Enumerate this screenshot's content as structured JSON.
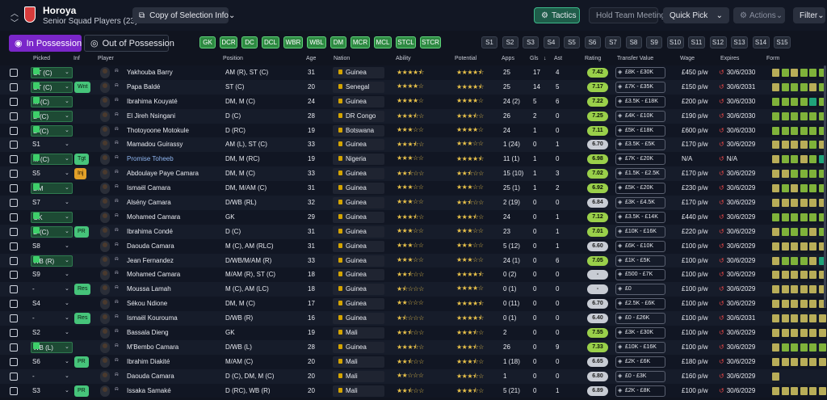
{
  "header": {
    "club_name": "Horoya",
    "squad_name": "Senior Squad Players (23)",
    "copy_label": "Copy of Selection Info",
    "tactics_label": "Tactics",
    "hold_meeting_label": "Hold Team Meeting",
    "quick_pick_label": "Quick Pick",
    "actions_label": "Actions",
    "filter_label": "Filter"
  },
  "tabs": {
    "in_possession": "In Possession",
    "out_possession": "Out of Possession"
  },
  "positions": [
    "GK",
    "DCR",
    "DC",
    "DCL",
    "WBR",
    "WBL",
    "DM",
    "MCR",
    "MCL",
    "STCL",
    "STCR"
  ],
  "subs": [
    "S1",
    "S2",
    "S3",
    "S4",
    "S5",
    "S6",
    "S7",
    "S8",
    "S9",
    "S10",
    "S11",
    "S12",
    "S13",
    "S14",
    "S15"
  ],
  "columns": {
    "picked": "Picked",
    "inf": "Inf",
    "player": "Player",
    "position": "Position",
    "age": "Age",
    "nation": "Nation",
    "ability": "Ability",
    "potential": "Potential",
    "apps": "Apps",
    "gls": "Gls",
    "ast": "Ast",
    "rating": "Rating",
    "transfer_value": "Transfer Value",
    "wage": "Wage",
    "expires": "Expires",
    "form": "Form"
  },
  "colors": {
    "good": "#46c47a",
    "accent": "#2e8a42",
    "form_green": "#7fb23a",
    "form_dark": "#4f8a1e",
    "form_yellow": "#b8ad58",
    "form_teal": "#1fa37a"
  },
  "players": [
    {
      "picked": "ST (C)",
      "set": true,
      "inf": "",
      "name": "Yakhouba Barry",
      "pos": "AM (R), ST (C)",
      "age": "31",
      "nat": "Guinea",
      "ab": 4.5,
      "pt": 4.5,
      "apps": "25",
      "gls": "17",
      "ast": "4",
      "rating": "7.42",
      "rt": "g",
      "tv": "£8K - £30K",
      "wage": "£450 p/w",
      "exp": "30/6/2030",
      "form": [
        "y",
        "g",
        "y",
        "g",
        "g",
        "g",
        "g"
      ]
    },
    {
      "picked": "ST (C)",
      "set": true,
      "inf": "Wnt",
      "name": "Papa Baldé",
      "pos": "ST (C)",
      "age": "20",
      "nat": "Senegal",
      "ab": 4,
      "pt": 4.5,
      "apps": "25",
      "gls": "14",
      "ast": "5",
      "rating": "7.17",
      "rt": "g",
      "tv": "£7K - £35K",
      "wage": "£150 p/w",
      "exp": "30/6/2031",
      "form": [
        "y",
        "g",
        "g",
        "g",
        "y",
        "g",
        "g"
      ]
    },
    {
      "picked": "M (C)",
      "set": true,
      "inf": "",
      "name": "Ibrahima Kouyaté",
      "pos": "DM, M (C)",
      "age": "24",
      "nat": "Guinea",
      "ab": 4,
      "pt": 4,
      "apps": "24 (2)",
      "gls": "5",
      "ast": "6",
      "rating": "7.22",
      "rt": "g",
      "tv": "£3.5K - £18K",
      "wage": "£200 p/w",
      "exp": "30/6/2030",
      "form": [
        "g",
        "g",
        "g",
        "g",
        "t",
        "g",
        "g"
      ]
    },
    {
      "picked": "D (C)",
      "set": true,
      "inf": "",
      "name": "El Jireh Nsingani",
      "pos": "D (C)",
      "age": "28",
      "nat": "DR Congo",
      "ab": 3.5,
      "pt": 3.5,
      "apps": "26",
      "gls": "2",
      "ast": "0",
      "rating": "7.25",
      "rt": "g",
      "tv": "£4K - £10K",
      "wage": "£190 p/w",
      "exp": "30/6/2030",
      "form": [
        "g",
        "g",
        "g",
        "g",
        "g",
        "g",
        "g"
      ]
    },
    {
      "picked": "D (C)",
      "set": true,
      "inf": "",
      "name": "Thotoyoone Motokule",
      "pos": "D (RC)",
      "age": "19",
      "nat": "Botswana",
      "ab": 3,
      "pt": 4,
      "apps": "24",
      "gls": "1",
      "ast": "0",
      "rating": "7.11",
      "rt": "g",
      "tv": "£5K - £18K",
      "wage": "£600 p/w",
      "exp": "30/6/2030",
      "form": [
        "g",
        "g",
        "g",
        "g",
        "g",
        "g",
        "g"
      ]
    },
    {
      "picked": "S1",
      "set": false,
      "inf": "",
      "name": "Mamadou Guirassy",
      "pos": "AM (L), ST (C)",
      "age": "33",
      "nat": "Guinea",
      "ab": 3.5,
      "pt": 3,
      "apps": "1 (24)",
      "gls": "0",
      "ast": "1",
      "rating": "6.70",
      "rt": "d",
      "tv": "£3.5K - £5K",
      "wage": "£170 p/w",
      "exp": "30/6/2029",
      "form": [
        "y",
        "y",
        "y",
        "y",
        "g",
        "y",
        "y"
      ]
    },
    {
      "picked": "M (C)",
      "set": true,
      "inf": "Tgt",
      "name": "Promise Toheeb",
      "link": true,
      "pos": "DM, M (RC)",
      "age": "19",
      "nat": "Nigeria",
      "ab": 3,
      "pt": 4.5,
      "apps": "11 (1)",
      "gls": "1",
      "ast": "0",
      "rating": "6.98",
      "rt": "g",
      "tv": "£7K - £20K",
      "wage": "N/A",
      "exp": "N/A",
      "noexp": true,
      "form": [
        "y",
        "g",
        "g",
        "y",
        "g",
        "t",
        "g"
      ]
    },
    {
      "picked": "S5",
      "set": false,
      "inf": "Inj",
      "amber": true,
      "name": "Abdoulaye Paye Camara",
      "pos": "DM, M (C)",
      "age": "33",
      "nat": "Guinea",
      "ab": 2.5,
      "pt": 2.5,
      "apps": "15 (10)",
      "gls": "1",
      "ast": "3",
      "rating": "7.02",
      "rt": "g",
      "tv": "£1.5K - £2.5K",
      "wage": "£170 p/w",
      "exp": "30/6/2029",
      "form": [
        "y",
        "y",
        "g",
        "g",
        "g",
        "g",
        "g"
      ]
    },
    {
      "picked": "DM",
      "set": true,
      "inf": "",
      "name": "Ismaël Camara",
      "pos": "DM, M/AM (C)",
      "age": "31",
      "nat": "Guinea",
      "ab": 3,
      "pt": 3,
      "apps": "25 (1)",
      "gls": "1",
      "ast": "2",
      "rating": "6.92",
      "rt": "g",
      "tv": "£5K - £20K",
      "wage": "£230 p/w",
      "exp": "30/6/2029",
      "form": [
        "y",
        "g",
        "y",
        "g",
        "g",
        "g",
        "g"
      ]
    },
    {
      "picked": "S7",
      "set": false,
      "inf": "",
      "name": "Alsény Camara",
      "pos": "D/WB (RL)",
      "age": "32",
      "nat": "Guinea",
      "ab": 3,
      "pt": 2.5,
      "apps": "2 (19)",
      "gls": "0",
      "ast": "0",
      "rating": "6.84",
      "rt": "d",
      "tv": "£3K - £4.5K",
      "wage": "£170 p/w",
      "exp": "30/6/2029",
      "form": [
        "y",
        "y",
        "y",
        "y",
        "y",
        "y",
        "y"
      ]
    },
    {
      "picked": "GK",
      "set": true,
      "inf": "",
      "name": "Mohamed Camara",
      "pos": "GK",
      "age": "29",
      "nat": "Guinea",
      "ab": 3.5,
      "pt": 3.5,
      "apps": "24",
      "gls": "0",
      "ast": "1",
      "rating": "7.12",
      "rt": "g",
      "tv": "£3.5K - £14K",
      "wage": "£440 p/w",
      "exp": "30/6/2029",
      "form": [
        "g",
        "g",
        "g",
        "g",
        "g",
        "g",
        "g"
      ]
    },
    {
      "picked": "D (C)",
      "set": true,
      "inf": "PR",
      "name": "Ibrahima Condé",
      "pos": "D (C)",
      "age": "31",
      "nat": "Guinea",
      "ab": 3,
      "pt": 3,
      "apps": "23",
      "gls": "0",
      "ast": "1",
      "rating": "7.01",
      "rt": "g",
      "tv": "£10K - £16K",
      "wage": "£220 p/w",
      "exp": "30/6/2029",
      "form": [
        "y",
        "g",
        "g",
        "g",
        "y",
        "g",
        "g"
      ]
    },
    {
      "picked": "S8",
      "set": false,
      "inf": "",
      "name": "Daouda Camara",
      "pos": "M (C), AM (RLC)",
      "age": "31",
      "nat": "Guinea",
      "ab": 3,
      "pt": 3,
      "apps": "5 (12)",
      "gls": "0",
      "ast": "1",
      "rating": "6.60",
      "rt": "d",
      "tv": "£6K - £10K",
      "wage": "£100 p/w",
      "exp": "30/6/2029",
      "form": [
        "y",
        "y",
        "y",
        "y",
        "y",
        "y",
        "y"
      ]
    },
    {
      "picked": "WB (R)",
      "set": true,
      "inf": "",
      "name": "Jean Fernandez",
      "pos": "D/WB/M/AM (R)",
      "age": "33",
      "nat": "Guinea",
      "ab": 3,
      "pt": 3,
      "apps": "24 (1)",
      "gls": "0",
      "ast": "6",
      "rating": "7.05",
      "rt": "g",
      "tv": "£1K - £5K",
      "wage": "£100 p/w",
      "exp": "30/6/2029",
      "form": [
        "y",
        "g",
        "g",
        "g",
        "y",
        "t",
        "g"
      ]
    },
    {
      "picked": "S9",
      "set": false,
      "inf": "",
      "name": "Mohamed Camara",
      "pos": "M/AM (R), ST (C)",
      "age": "18",
      "nat": "Guinea",
      "ab": 2.5,
      "pt": 4.5,
      "apps": "0 (2)",
      "gls": "0",
      "ast": "0",
      "rating": "-",
      "rt": "d",
      "tv": "£500 - £7K",
      "wage": "£100 p/w",
      "exp": "30/6/2029",
      "form": [
        "y",
        "y",
        "y",
        "y",
        "y",
        "y",
        "y"
      ]
    },
    {
      "picked": "-",
      "set": false,
      "inf": "Res",
      "name": "Moussa Lamah",
      "pos": "M (C), AM (LC)",
      "age": "18",
      "nat": "Guinea",
      "ab": 1.5,
      "pt": 4,
      "apps": "0 (1)",
      "gls": "0",
      "ast": "0",
      "rating": "-",
      "rt": "d",
      "tv": "£0",
      "wage": "£100 p/w",
      "exp": "30/6/2029",
      "form": [
        "y",
        "y",
        "y",
        "y",
        "y",
        "y",
        "y"
      ]
    },
    {
      "picked": "S4",
      "set": false,
      "inf": "",
      "name": "Sékou Ndione",
      "pos": "DM, M (C)",
      "age": "17",
      "nat": "Guinea",
      "ab": 2,
      "pt": 4.5,
      "apps": "0 (11)",
      "gls": "0",
      "ast": "0",
      "rating": "6.70",
      "rt": "d",
      "tv": "£2.5K - £6K",
      "wage": "£100 p/w",
      "exp": "30/6/2029",
      "form": [
        "y",
        "y",
        "y",
        "y",
        "y",
        "y",
        "y"
      ]
    },
    {
      "picked": "-",
      "set": false,
      "inf": "Res",
      "name": "Ismaël Kourouma",
      "pos": "D/WB (R)",
      "age": "16",
      "nat": "Guinea",
      "ab": 1.5,
      "pt": 4.5,
      "apps": "0 (1)",
      "gls": "0",
      "ast": "0",
      "rating": "6.40",
      "rt": "d",
      "tv": "£0 - £26K",
      "wage": "£100 p/w",
      "exp": "30/6/2031",
      "form": [
        "y",
        "y",
        "y",
        "y",
        "y",
        "y",
        "y"
      ]
    },
    {
      "picked": "S2",
      "set": false,
      "inf": "",
      "name": "Bassala Dieng",
      "pos": "GK",
      "age": "19",
      "nat": "Mali",
      "ab": 2.5,
      "pt": 3.5,
      "apps": "2",
      "gls": "0",
      "ast": "0",
      "rating": "7.55",
      "rt": "g",
      "tv": "£3K - £30K",
      "wage": "£100 p/w",
      "exp": "30/6/2029",
      "form": [
        "y",
        "y",
        "y",
        "y",
        "y",
        "y",
        "y"
      ]
    },
    {
      "picked": "WB (L)",
      "set": true,
      "inf": "",
      "name": "M'Bembo Camara",
      "pos": "D/WB (L)",
      "age": "28",
      "nat": "Guinea",
      "ab": 3.5,
      "pt": 3.5,
      "apps": "26",
      "gls": "0",
      "ast": "9",
      "rating": "7.33",
      "rt": "g",
      "tv": "£10K - £16K",
      "wage": "£100 p/w",
      "exp": "30/6/2029",
      "form": [
        "y",
        "g",
        "g",
        "g",
        "g",
        "g",
        "g"
      ]
    },
    {
      "picked": "S6",
      "set": false,
      "inf": "PR",
      "name": "Ibrahim Diakité",
      "pos": "M/AM (C)",
      "age": "20",
      "nat": "Mali",
      "ab": 2.5,
      "pt": 3.5,
      "apps": "1 (18)",
      "gls": "0",
      "ast": "0",
      "rating": "6.65",
      "rt": "d",
      "tv": "£2K - £6K",
      "wage": "£180 p/w",
      "exp": "30/6/2029",
      "form": [
        "y",
        "y",
        "y",
        "y",
        "y",
        "y",
        "y"
      ]
    },
    {
      "picked": "-",
      "set": false,
      "inf": "",
      "name": "Daouda Camara",
      "pos": "D (C), DM, M (C)",
      "age": "20",
      "nat": "Mali",
      "ab": 2,
      "pt": 3.5,
      "apps": "1",
      "gls": "0",
      "ast": "0",
      "rating": "6.80",
      "rt": "d",
      "tv": "£0 - £3K",
      "wage": "£160 p/w",
      "exp": "30/6/2029",
      "form": [
        "y"
      ]
    },
    {
      "picked": "S3",
      "set": false,
      "inf": "PR",
      "name": "Issaka Samaké",
      "pos": "D (RC), WB (R)",
      "age": "20",
      "nat": "Mali",
      "ab": 2.5,
      "pt": 3.5,
      "apps": "5 (21)",
      "gls": "0",
      "ast": "1",
      "rating": "6.89",
      "rt": "d",
      "tv": "£2K - £8K",
      "wage": "£100 p/w",
      "exp": "30/6/2029",
      "form": [
        "y",
        "y",
        "y",
        "y",
        "y",
        "y",
        "y"
      ]
    }
  ]
}
